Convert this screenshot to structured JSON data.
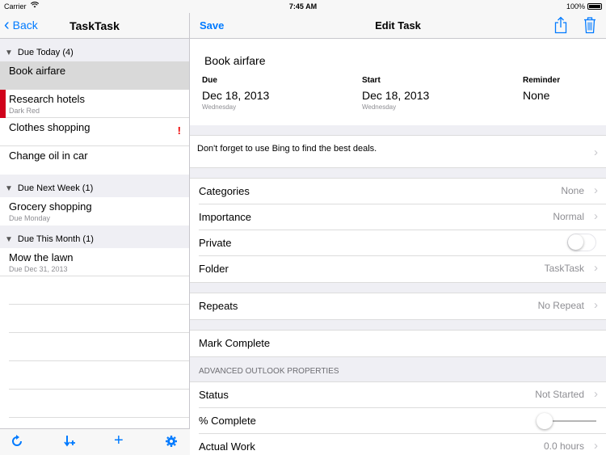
{
  "status_bar": {
    "carrier": "Carrier",
    "time": "7:45 AM",
    "battery": "100%"
  },
  "left": {
    "back_label": "Back",
    "title": "TaskTask",
    "sections": [
      {
        "header": "Due Today (4)"
      },
      {
        "header": "Due Next Week (1)"
      },
      {
        "header": "Due This Month (1)"
      }
    ],
    "tasks": [
      {
        "name": "Book airfare"
      },
      {
        "name": "Research hotels",
        "sub": "Dark Red"
      },
      {
        "name": "Clothes shopping",
        "priority_mark": "!"
      },
      {
        "name": "Change oil in car"
      },
      {
        "name": "Grocery shopping",
        "sub": "Due Monday"
      },
      {
        "name": "Mow the lawn",
        "sub": "Due Dec 31, 2013"
      }
    ],
    "toolbar": {
      "refresh_icon": "↻",
      "filter_icon": "⇟",
      "add_icon": "+",
      "settings_icon": "⚙"
    }
  },
  "right": {
    "save_label": "Save",
    "title": "Edit Task",
    "task_title": "Book airfare",
    "due": {
      "label": "Due",
      "value": "Dec 18, 2013",
      "sub": "Wednesday"
    },
    "start": {
      "label": "Start",
      "value": "Dec 18, 2013",
      "sub": "Wednesday"
    },
    "reminder": {
      "label": "Reminder",
      "value": "None"
    },
    "notes": "Don't forget to use Bing to find the best deals.",
    "categories": {
      "label": "Categories",
      "value": "None"
    },
    "importance": {
      "label": "Importance",
      "value": "Normal"
    },
    "private": {
      "label": "Private",
      "on": false
    },
    "folder": {
      "label": "Folder",
      "value": "TaskTask"
    },
    "repeats": {
      "label": "Repeats",
      "value": "No Repeat"
    },
    "mark_complete": "Mark Complete",
    "advanced_header": "ADVANCED OUTLOOK PROPERTIES",
    "status": {
      "label": "Status",
      "value": "Not Started"
    },
    "percent_complete": {
      "label": "% Complete",
      "value": 0
    },
    "actual_work": {
      "label": "Actual Work",
      "value": "0.0 hours"
    }
  },
  "colors": {
    "accent": "#007aff",
    "flag_red": "#d0021b"
  }
}
